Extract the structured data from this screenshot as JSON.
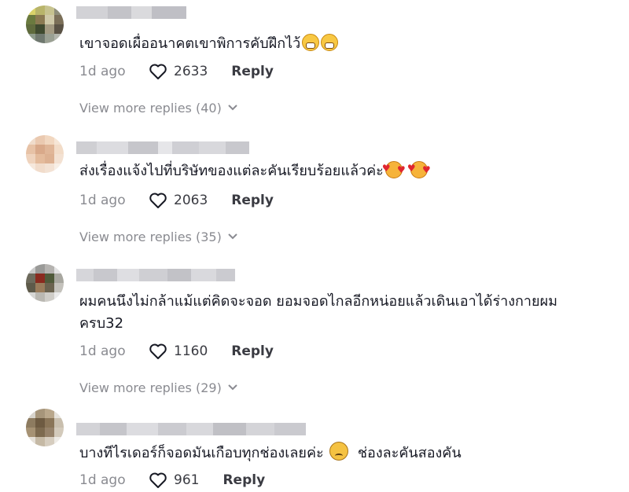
{
  "comments": [
    {
      "text": "เขาจอดเผื่ออนาคตเขาพิการคับฝึกไว้",
      "emojis": [
        "grin-icon",
        "grin-icon"
      ],
      "time": "1d ago",
      "likes": "2633",
      "reply_label": "Reply",
      "more_replies": "View more replies (40)"
    },
    {
      "text": "ส่งเรื่องแจ้งไปที่บริษัทของแต่ละคันเรียบร้อยแล้วค่ะ",
      "emojis": [
        "smiling-hearts-icon",
        "smiling-hearts-icon"
      ],
      "time": "1d ago",
      "likes": "2063",
      "reply_label": "Reply",
      "more_replies": "View more replies (35)"
    },
    {
      "text": "ผมคนนึงไม่กล้าแม้แต่คิดจะจอด ยอมจอดไกลอีกหน่อยแล้วเดินเอาได้ร่างกายผม\nครบ32",
      "emojis": [],
      "time": "1d ago",
      "likes": "1160",
      "reply_label": "Reply",
      "more_replies": "View more replies (29)"
    },
    {
      "text_before": "บางทีไรเดอร์ก็จอดมันเกือบทุกช่องเลยค่ะ",
      "text_after": "ช่องละคันสองคัน",
      "emojis": [
        "sad-face-icon"
      ],
      "time": "1d ago",
      "likes": "961",
      "reply_label": "Reply"
    }
  ],
  "colors": {
    "text": "#161823",
    "muted": "#8a8b91",
    "action": "#3a3b42"
  }
}
